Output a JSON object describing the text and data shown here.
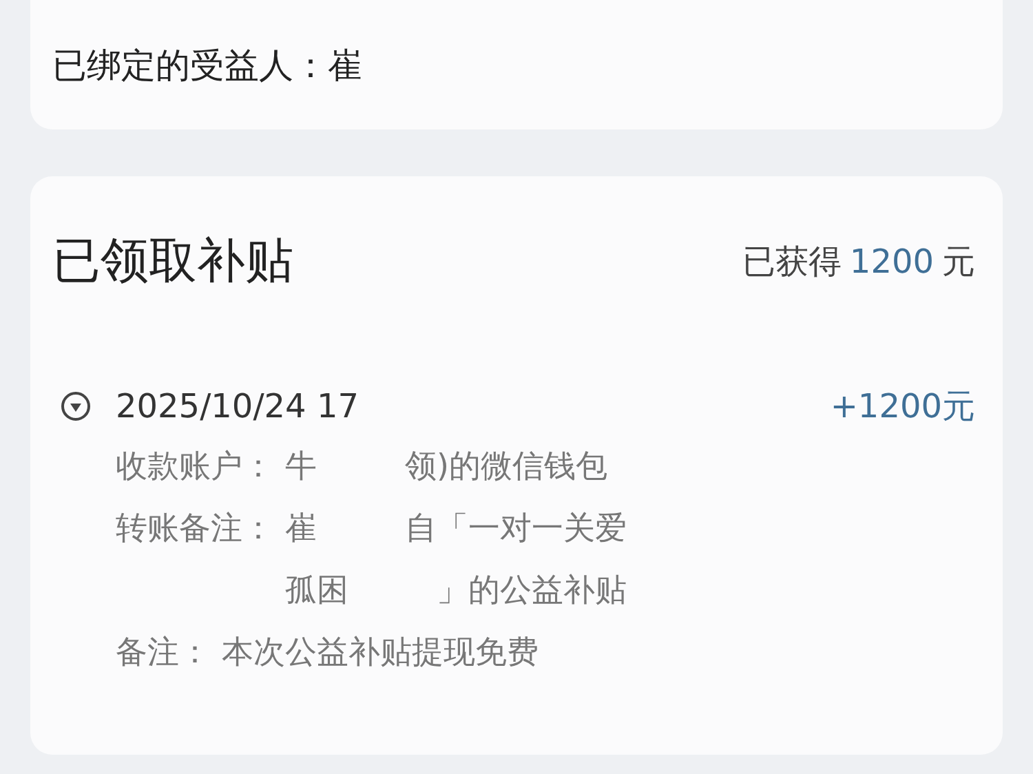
{
  "beneficiary": {
    "label": "已绑定的受益人：",
    "value": "崔"
  },
  "subsidy": {
    "title": "已领取补贴",
    "earned_prefix": "已获得",
    "earned_amount": "1200",
    "earned_unit": "元",
    "records": [
      {
        "time": "2025/10/24 17",
        "amount": "+1200元",
        "details": [
          {
            "label": "收款账户：",
            "lines": [
              [
                "牛",
                "领)的微信钱包"
              ]
            ]
          },
          {
            "label": "转账备注：",
            "lines": [
              [
                "崔",
                "自「一对一关爱"
              ],
              [
                "孤困",
                "」的公益补贴"
              ]
            ]
          },
          {
            "label": "备注：",
            "lines": [
              [
                "本次公益补贴提现免费"
              ]
            ]
          }
        ]
      }
    ]
  }
}
